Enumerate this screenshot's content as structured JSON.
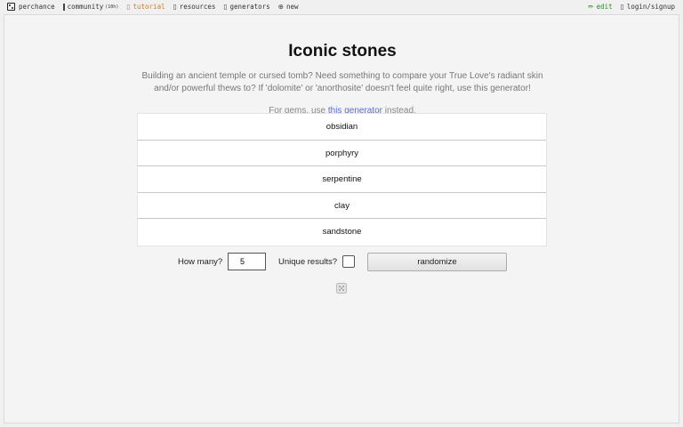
{
  "nav": {
    "left": [
      {
        "label": "perchance",
        "icon": "die-icon"
      },
      {
        "label": "community",
        "count": "(10h)",
        "icon": "chat-icon"
      },
      {
        "label": "tutorial",
        "icon": "book-icon"
      },
      {
        "label": "resources",
        "icon": "doc-icon"
      },
      {
        "label": "generators",
        "icon": "list-icon"
      },
      {
        "label": "new",
        "icon": "plus-circle-icon"
      }
    ],
    "right": [
      {
        "label": "edit",
        "icon": "pencil-icon"
      },
      {
        "label": "login/signup",
        "icon": "user-icon"
      }
    ]
  },
  "page": {
    "title": "Iconic stones",
    "description": "Building an ancient temple or cursed tomb? Need something to compare your True Love's radiant skin and/or powerful thews to? If 'dolomite' or 'anorthosite' doesn't feel quite right, use this generator!",
    "note_prefix": "For gems, use ",
    "note_link": "this generator",
    "note_suffix": " instead."
  },
  "results": [
    "obsidian",
    "porphyry",
    "serpentine",
    "clay",
    "sandstone"
  ],
  "controls": {
    "how_many_label": "How many?",
    "how_many_value": "5",
    "unique_label": "Unique results?",
    "randomize_label": "randomize"
  },
  "colors": {
    "tutorial": "#d97a1e",
    "edit": "#2c8a2c",
    "link": "#5b6fd6"
  }
}
